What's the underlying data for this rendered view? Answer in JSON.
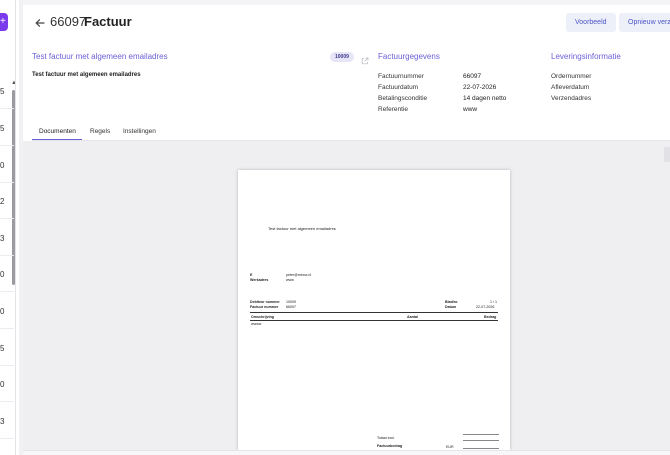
{
  "header": {
    "invoice_number": "66097",
    "title": "Factuur",
    "buttons": {
      "preview": "Voorbeeld",
      "resend": "Opnieuw verze"
    }
  },
  "left_strip": {
    "add_label": "+",
    "rows": [
      "5",
      "5",
      "0",
      "2",
      "3",
      "0",
      "0",
      "5",
      "0",
      "3"
    ]
  },
  "summary": {
    "title": "Test factuur met algemeen emailadres",
    "badge": "10009",
    "subtitle": "Test factuur met algemeen emailadres"
  },
  "invoice_details": {
    "heading": "Factuurgegevens",
    "fields": [
      {
        "label": "Factuurnummer",
        "value": "66097"
      },
      {
        "label": "Factuurdatum",
        "value": "22-07-2026"
      },
      {
        "label": "Betalingsconditie",
        "value": "14 dagen netto"
      },
      {
        "label": "Referentie",
        "value": "www"
      }
    ]
  },
  "delivery": {
    "heading": "Leveringsinformatie",
    "fields": [
      "Ordernummer",
      "Afleverdatum",
      "Verzendadres"
    ]
  },
  "tabs": [
    "Documenten",
    "Regels",
    "Instellingen"
  ],
  "document": {
    "heading": "Test factuur met algemeen emailadres",
    "email_label": "E",
    "email_value": "peter@minox.nl",
    "workaddress_label": "Werkadres",
    "workaddress_value": "www",
    "debtor_label": "Debiteur nummer",
    "debtor_value": "10009",
    "invoice_label": "Factuur nummer",
    "invoice_value": "66097",
    "page_label": "Blad/nr.",
    "page_value": "1 / 1",
    "date_label": "Datum",
    "date_value": "22-07-2026",
    "col_description": "Omschrijving",
    "col_qty": "Aantal",
    "col_amount": "Bedrag",
    "line_item": "wwww",
    "total_excl": "Totaal excl.",
    "invoice_amount": "Factuurbedrag",
    "currency": "EUR"
  },
  "colors": {
    "accent": "#6b5fd6",
    "button_bg": "#eef0f9",
    "button_text": "#4a55c9",
    "add_button": "#7c3aed"
  }
}
